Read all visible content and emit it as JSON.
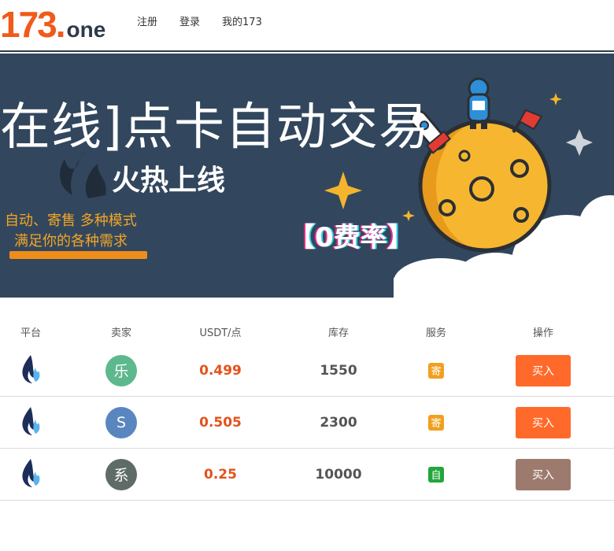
{
  "header": {
    "logo": {
      "number": "173",
      "dot": ".",
      "tld": "one"
    },
    "nav": [
      {
        "label": "注册"
      },
      {
        "label": "登录"
      },
      {
        "label": "我的173"
      }
    ]
  },
  "banner": {
    "title": "在线]点卡自动交易",
    "subtitle": "火热上线",
    "left_line1": "自动、寄售 多种模式",
    "left_line2": "满足你的各种需求",
    "rate_text": "【0费率】",
    "colors": {
      "background": "#32475e",
      "accent": "#f4a524"
    }
  },
  "table": {
    "headers": {
      "platform": "平台",
      "seller": "卖家",
      "price": "USDT/点",
      "stock": "库存",
      "service": "服务",
      "action": "操作"
    },
    "rows": [
      {
        "platform_icon": "flame-logo-icon",
        "seller": "乐",
        "seller_color": "#5db88e",
        "price": "0.499",
        "stock": "1550",
        "service": "寄",
        "service_color": "#f0a020",
        "buy_label": "买入",
        "buy_color": "#ff6a2a"
      },
      {
        "platform_icon": "flame-logo-icon",
        "seller": "S",
        "seller_color": "#5a86c0",
        "price": "0.505",
        "stock": "2300",
        "service": "寄",
        "service_color": "#f0a020",
        "buy_label": "买入",
        "buy_color": "#ff6a2a"
      },
      {
        "platform_icon": "flame-logo-icon",
        "seller": "系",
        "seller_color": "#5f6b66",
        "price": "0.25",
        "stock": "10000",
        "service": "自",
        "service_color": "#22a63a",
        "buy_label": "买入",
        "buy_color": "#9c7b6e"
      }
    ]
  }
}
